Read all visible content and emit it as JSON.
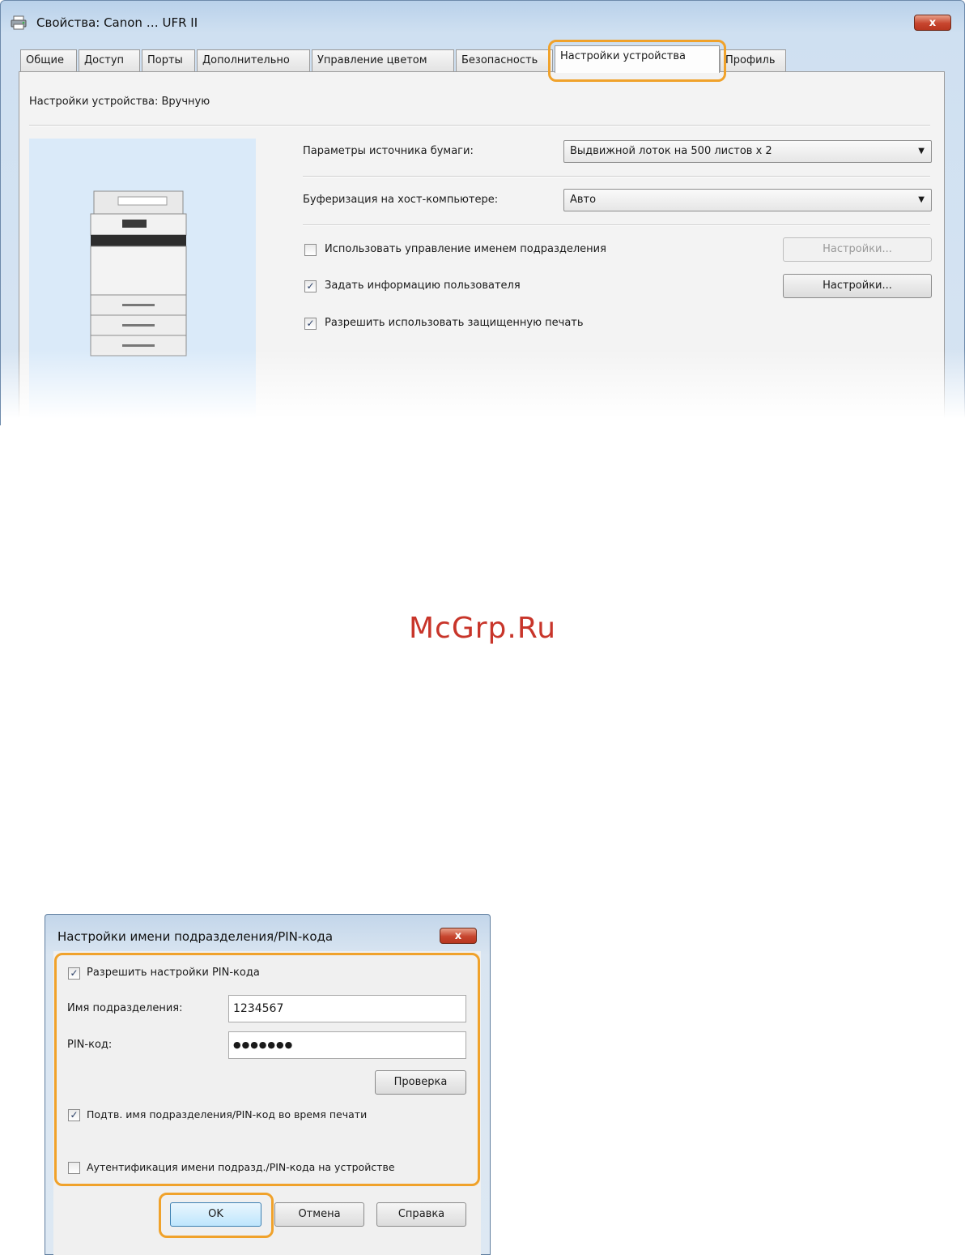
{
  "top_window": {
    "title": "Свойства: Canon … UFR II",
    "close_label": "x",
    "tabs": [
      "Общие",
      "Доступ",
      "Порты",
      "Дополнительно",
      "Управление цветом",
      "Безопасность",
      "Настройки устройства",
      "Профиль"
    ],
    "active_tab": "Настройки устройства",
    "header_text": "Настройки устройства: Вручную",
    "paper_source": {
      "label": "Параметры источника бумаги:",
      "value": "Выдвижной лоток на 500 листов x 2"
    },
    "spooling": {
      "label": "Буферизация на хост-компьютере:",
      "value": "Авто"
    },
    "dept_id": {
      "label": "Использовать управление именем подразделения",
      "checked": false,
      "button": "Настройки..."
    },
    "user_info": {
      "label": "Задать информацию пользователя",
      "checked": true,
      "button": "Настройки..."
    },
    "secure_print": {
      "label": "Разрешить использовать защищенную печать",
      "checked": true
    }
  },
  "watermark": "McGrp.Ru",
  "dialog": {
    "title": "Настройки имени подразделения/PIN-кода",
    "close_label": "x",
    "allow_pin": {
      "label": "Разрешить настройки PIN-кода",
      "checked": true
    },
    "dept_name": {
      "label": "Имя подразделения:",
      "value": "1234567"
    },
    "pin": {
      "label": "PIN-код:",
      "value": "●●●●●●●"
    },
    "verify_button": "Проверка",
    "confirm_on_print": {
      "label": "Подтв. имя подразделения/PIN-код во время печати",
      "checked": true
    },
    "authenticate_on_device": {
      "label": "Аутентификация имени подразд./PIN-кода на устройстве",
      "checked": false
    },
    "ok_button": "OK",
    "cancel_button": "Отмена",
    "help_button": "Справка"
  },
  "colors": {
    "highlight": "#f0a22b",
    "watermark": "#c8352a",
    "close_button": "#c7452e"
  }
}
